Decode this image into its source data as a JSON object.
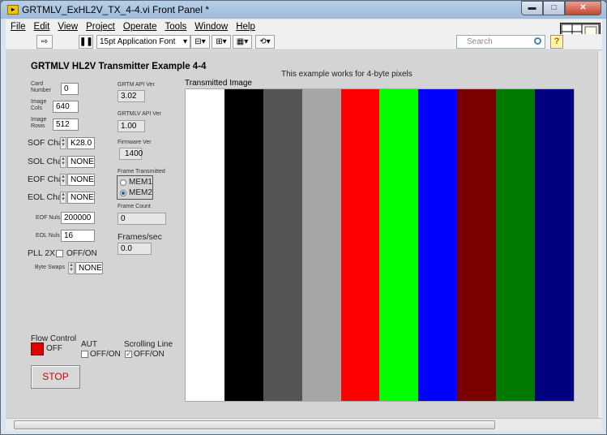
{
  "window": {
    "title": "GRTMLV_ExHL2V_TX_4-4.vi Front Panel *",
    "min_label": "▬",
    "max_label": "□",
    "close_label": "✕"
  },
  "menu": [
    "File",
    "Edit",
    "View",
    "Project",
    "Operate",
    "Tools",
    "Window",
    "Help"
  ],
  "toolbar": {
    "font": "15pt Application Font",
    "search_placeholder": "Search",
    "help_label": "?"
  },
  "panel": {
    "heading": "GRTMLV HL2V Transmitter Example 4-4",
    "note": "This example works for 4-byte pixels",
    "image_label": "Transmitted Image",
    "card_number": {
      "label": "Card Number",
      "value": "0"
    },
    "image_cols": {
      "label": "Image Cols",
      "value": "640"
    },
    "image_rows": {
      "label": "Image Rows",
      "value": "512"
    },
    "sof_char": {
      "label": "SOF Char",
      "value": "K28.0"
    },
    "sol_char": {
      "label": "SOL Char",
      "value": "NONE"
    },
    "eof_char": {
      "label": "EOF Char",
      "value": "NONE"
    },
    "eol_char": {
      "label": "EOL Char",
      "value": "NONE"
    },
    "eof_nuls": {
      "label": "EOF Nuls",
      "value": "200000"
    },
    "eol_nuls": {
      "label": "EOL Nuls",
      "value": "16"
    },
    "pll_2x": {
      "label": "PLL 2X",
      "toggle": "OFF/ON"
    },
    "byte_swaps": {
      "label": "Byte Swaps",
      "value": "NONE"
    },
    "grtm_api_ver": {
      "label": "GRTM API Ver",
      "value": "3.02"
    },
    "grtmlv_api_ver": {
      "label": "GRTMLV API Ver",
      "value": "1.00"
    },
    "firmware_ver": {
      "label": "Firmware Ver",
      "value": "1400"
    },
    "frame_transmitted": {
      "label": "Frame Transmitted",
      "options": [
        "MEM1",
        "MEM2"
      ],
      "selected": "MEM2"
    },
    "frame_count": {
      "label": "Frame Count",
      "value": "0"
    },
    "frames_per_sec": {
      "label": "Frames/sec",
      "value": "0.0"
    },
    "flow_control": {
      "label": "Flow Control",
      "state": "OFF"
    },
    "aut": {
      "label": "AUT",
      "toggle": "OFF/ON"
    },
    "scrolling_line": {
      "label": "Scrolling Line",
      "toggle": "OFF/ON"
    },
    "stop_label": "STOP"
  },
  "stripes": [
    "#ffffff",
    "#000000",
    "#555555",
    "#a6a6a6",
    "#ff0000",
    "#00ff00",
    "#0000ff",
    "#7a0000",
    "#007a00",
    "#000080"
  ]
}
